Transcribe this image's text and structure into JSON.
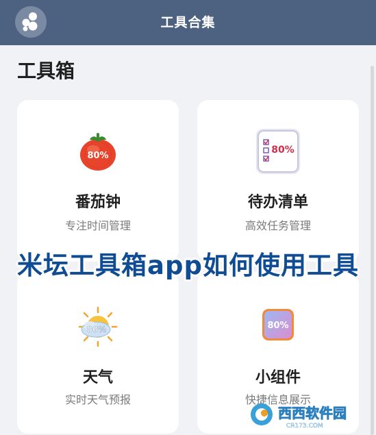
{
  "header": {
    "title": "工具合集"
  },
  "section": {
    "title": "工具箱"
  },
  "cards": [
    {
      "name": "番茄钟",
      "desc": "专注时间管理",
      "icon": "tomato-timer-icon",
      "badge": "80%"
    },
    {
      "name": "待办清单",
      "desc": "高效任务管理",
      "icon": "todo-list-icon",
      "badge": "80%"
    },
    {
      "name": "天气",
      "desc": "实时天气预报",
      "icon": "weather-icon",
      "badge": "80%"
    },
    {
      "name": "小组件",
      "desc": "快捷信息展示",
      "icon": "widget-icon",
      "badge": "80%"
    }
  ],
  "overlay": {
    "text": "米坛工具箱app如何使用工具"
  },
  "watermark": {
    "text": "西西软件园",
    "subtext": "CR173.COM"
  },
  "colors": {
    "header": "#4d6180",
    "overlay_text": "#0f4c93",
    "background": "#f1f2f5"
  }
}
